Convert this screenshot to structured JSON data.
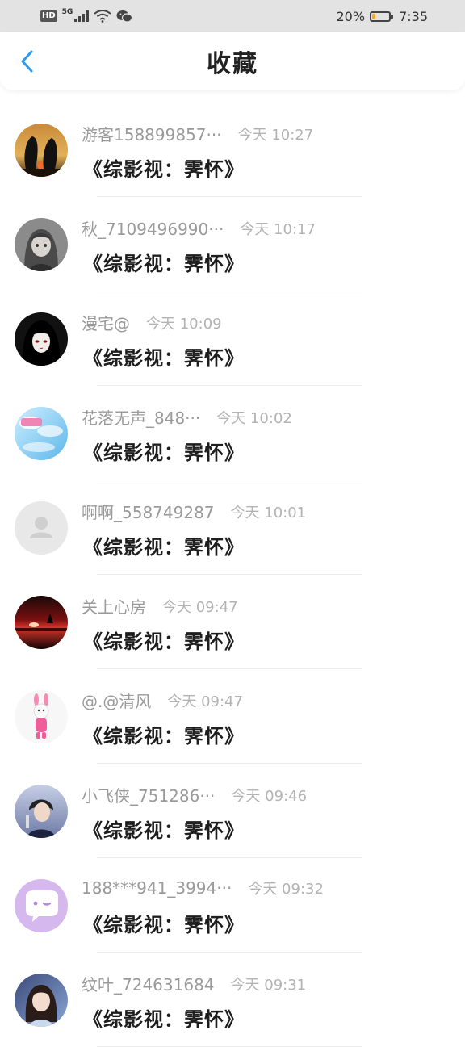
{
  "status_bar": {
    "hd": "HD",
    "network": "5G",
    "battery_text": "20%",
    "battery_level": 0.2,
    "clock": "7:35"
  },
  "header": {
    "title": "收藏"
  },
  "colors": {
    "accent": "#2b9bf4",
    "status_bar_bg": "#e3e3e3",
    "battery_fill": "#f5a623"
  },
  "favorites": [
    {
      "user": "游客158899857···",
      "time": "今天 10:27",
      "title": "《综影视：霁怀》",
      "avatar": "penguin-silhouette-sunset"
    },
    {
      "user": "秋_7109496990···",
      "time": "今天 10:17",
      "title": "《综影视：霁怀》",
      "avatar": "grey-anime-girl"
    },
    {
      "user": "漫宅@",
      "time": "今天 10:09",
      "title": "《综影视：霁怀》",
      "avatar": "dark-anime-girl"
    },
    {
      "user": "花落无声_848···",
      "time": "今天 10:02",
      "title": "《综影视：霁怀》",
      "avatar": "blue-sky-pink"
    },
    {
      "user": "啊啊_558749287",
      "time": "今天 10:01",
      "title": "《综影视：霁怀》",
      "avatar": "default-user"
    },
    {
      "user": "关上心房",
      "time": "今天 09:47",
      "title": "《综影视：霁怀》",
      "avatar": "red-sunset"
    },
    {
      "user": "@.@清风",
      "time": "今天 09:47",
      "title": "《综影视：霁怀》",
      "avatar": "pink-plush-bunny"
    },
    {
      "user": "小飞侠_751286···",
      "time": "今天 09:46",
      "title": "《综影视：霁怀》",
      "avatar": "boy-portrait"
    },
    {
      "user": "188***941_3994···",
      "time": "今天 09:32",
      "title": "《综影视：霁怀》",
      "avatar": "purple-chat-bubble"
    },
    {
      "user": "纹叶_724631684",
      "time": "今天 09:31",
      "title": "《综影视：霁怀》",
      "avatar": "girl-portrait"
    }
  ]
}
